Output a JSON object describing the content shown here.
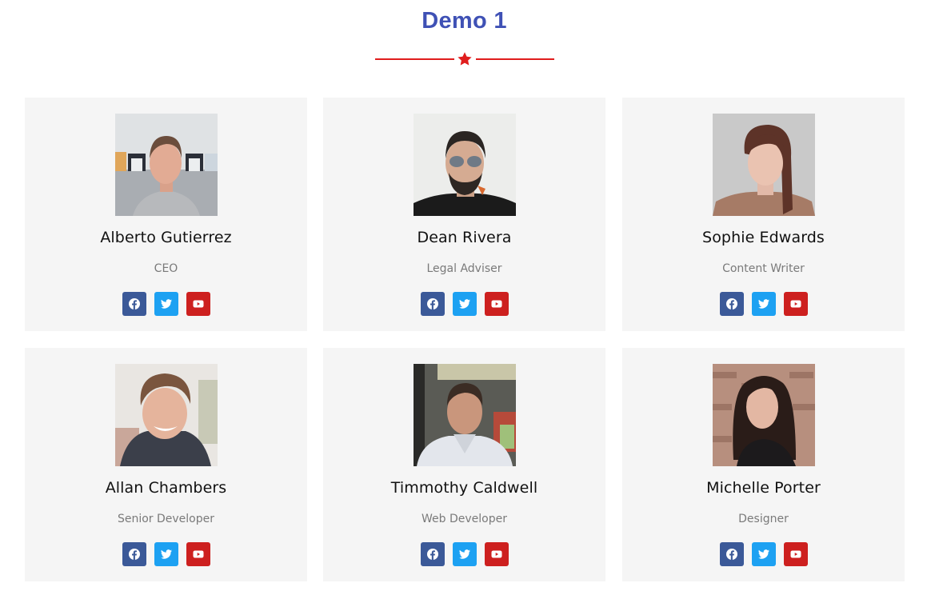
{
  "page": {
    "title": "Demo 1",
    "divider_icon": "star-icon",
    "colors": {
      "title": "#3f51b5",
      "divider": "#e01d1d",
      "card_bg": "#f5f5f5",
      "facebook": "#3b5998",
      "twitter": "#1da1f2",
      "youtube": "#cd201f"
    }
  },
  "team": [
    {
      "name": "Alberto Gutierrez",
      "position": "CEO",
      "photo": "photo-alberto-gutierrez",
      "socials": [
        {
          "icon": "facebook-icon"
        },
        {
          "icon": "twitter-icon"
        },
        {
          "icon": "youtube-icon"
        }
      ]
    },
    {
      "name": "Dean Rivera",
      "position": "Legal Adviser",
      "photo": "photo-dean-rivera",
      "socials": [
        {
          "icon": "facebook-icon"
        },
        {
          "icon": "twitter-icon"
        },
        {
          "icon": "youtube-icon"
        }
      ]
    },
    {
      "name": "Sophie Edwards",
      "position": "Content Writer",
      "photo": "photo-sophie-edwards",
      "socials": [
        {
          "icon": "facebook-icon"
        },
        {
          "icon": "twitter-icon"
        },
        {
          "icon": "youtube-icon"
        }
      ]
    },
    {
      "name": "Allan Chambers",
      "position": "Senior Developer",
      "photo": "photo-allan-chambers",
      "socials": [
        {
          "icon": "facebook-icon"
        },
        {
          "icon": "twitter-icon"
        },
        {
          "icon": "youtube-icon"
        }
      ]
    },
    {
      "name": "Timmothy Caldwell",
      "position": "Web Developer",
      "photo": "photo-timmothy-caldwell",
      "socials": [
        {
          "icon": "facebook-icon"
        },
        {
          "icon": "twitter-icon"
        },
        {
          "icon": "youtube-icon"
        }
      ]
    },
    {
      "name": "Michelle Porter",
      "position": "Designer",
      "photo": "photo-michelle-porter",
      "socials": [
        {
          "icon": "facebook-icon"
        },
        {
          "icon": "twitter-icon"
        },
        {
          "icon": "youtube-icon"
        }
      ]
    }
  ]
}
